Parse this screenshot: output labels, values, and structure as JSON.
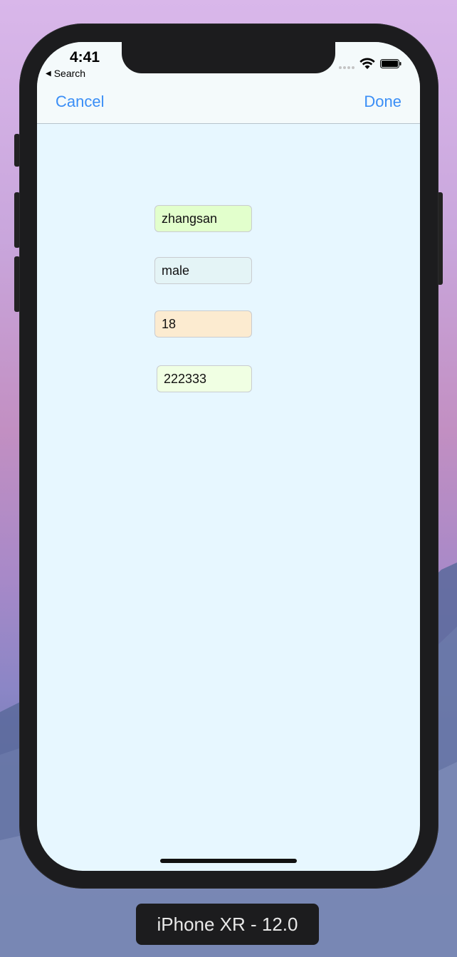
{
  "status_bar": {
    "time": "4:41",
    "back_label": "Search",
    "back_icon": "back-triangle-icon"
  },
  "nav": {
    "cancel_label": "Cancel",
    "done_label": "Done",
    "accent_color": "#3a8ef6"
  },
  "form": {
    "fields": [
      {
        "value": "zhangsan",
        "bg_color": "#e2ffcc"
      },
      {
        "value": "male",
        "bg_color": "#e4f4f6"
      },
      {
        "value": "18",
        "bg_color": "#fcebd0"
      },
      {
        "value": "222333",
        "bg_color": "#f0ffe3"
      }
    ]
  },
  "device": {
    "label": "iPhone XR - 12.0"
  }
}
